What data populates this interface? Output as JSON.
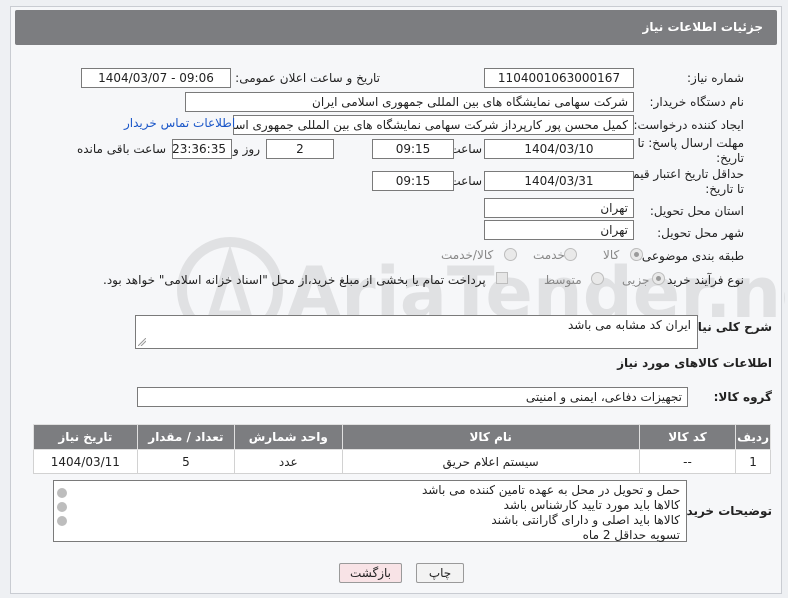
{
  "header": {
    "title": "جزئیات اطلاعات نیاز"
  },
  "fields": {
    "need_number_label": "شماره نیاز:",
    "need_number": "1104001063000167",
    "announce_label": "تاریخ و ساعت اعلان عمومی:",
    "announce_value": "1404/03/07 - 09:06",
    "buyer_org_label": "نام دستگاه خریدار:",
    "buyer_org": "شرکت سهامی نمایشگاه های بین المللی جمهوری اسلامی ایران",
    "creator_label": "ایجاد کننده درخواست:",
    "creator": "کمیل محسن پور کارپرداز شرکت سهامی نمایشگاه های بین المللی جمهوری اسلامی ایران",
    "contact_link": "اطلاعات تماس خریدار",
    "deadline_label_1": "مهلت ارسال پاسخ: تا",
    "deadline_label_2": "تاریخ:",
    "deadline_date": "1404/03/10",
    "time_label": "ساعت",
    "deadline_time": "09:15",
    "days_value": "2",
    "days_label": "روز و",
    "remaining_time": "23:36:35",
    "remaining_label": "ساعت باقی مانده",
    "min_valid_label_1": "حداقل تاریخ اعتبار قیمت:",
    "min_valid_label_2": "تا تاریخ:",
    "valid_date": "1404/03/31",
    "valid_time": "09:15",
    "province_label": "استان محل تحویل:",
    "province": "تهران",
    "city_label": "شهر محل تحویل:",
    "city": "تهران",
    "category_label": "طبقه بندی موضوعی:",
    "category_options": [
      "کالا",
      "خدمت",
      "کالا/خدمت"
    ],
    "process_label": "نوع فرآیند خرید :",
    "process_options": [
      "جزیی",
      "متوسط"
    ],
    "payment_note": "پرداخت تمام یا بخشی از مبلغ خرید،از محل \"اسناد خزانه اسلامی\" خواهد بود."
  },
  "description": {
    "label": "شرح کلی نیاز:",
    "text": "ایران کد مشابه می باشد"
  },
  "goods_section": {
    "title": "اطلاعات کالاهای مورد نیاز",
    "group_label": "گروه کالا:",
    "group_value": "تجهیزات دفاعی، ایمنی و امنیتی"
  },
  "table": {
    "headers": [
      "ردیف",
      "کد کالا",
      "نام کالا",
      "واحد شمارش",
      "تعداد / مقدار",
      "تاریخ نیاز"
    ],
    "rows": [
      [
        "1",
        "--",
        "سیستم اعلام حریق",
        "عدد",
        "5",
        "1404/03/11"
      ]
    ]
  },
  "notes": {
    "label": "توضیحات خریدار:",
    "lines": [
      "حمل و تحویل در  محل به عهده تامین کننده می باشد",
      "کالاها باید مورد تایید کارشناس باشد",
      "کالاها باید اصلی و دارای گارانتی باشند",
      "تسویه حداقل 2 ماه"
    ]
  },
  "buttons": {
    "print": "چاپ",
    "back": "بازگشت"
  },
  "watermark": {
    "text": "AriaTender.neT"
  },
  "colors": {
    "header_bg": "#7c7d80",
    "link": "#1a56c8",
    "back_btn": "#f8e3e6"
  }
}
